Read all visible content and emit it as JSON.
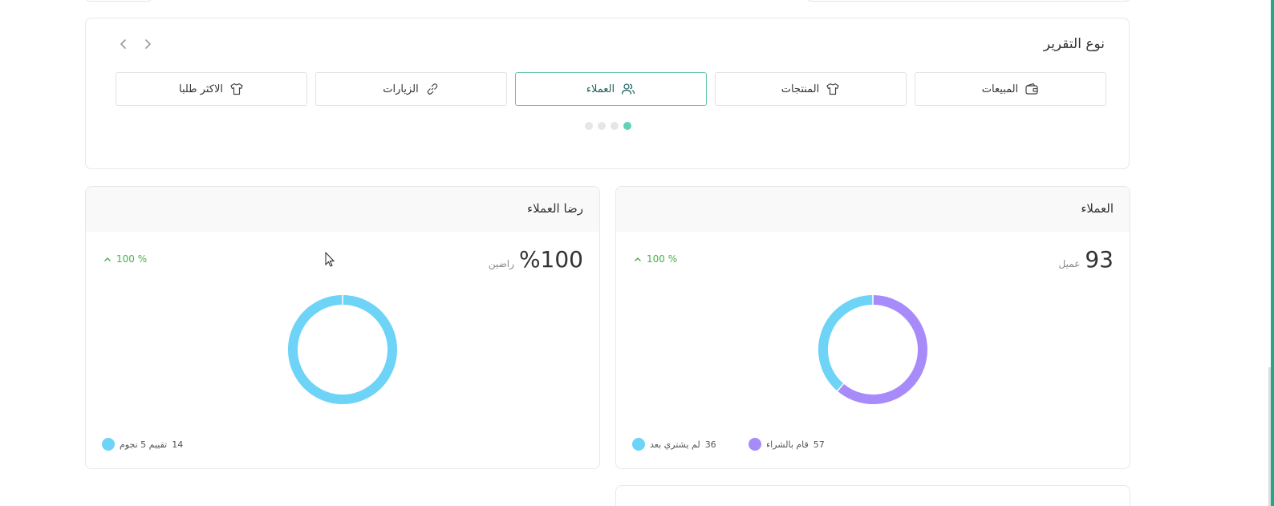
{
  "report_section": {
    "title": "نوع التقرير",
    "tabs": [
      {
        "label": "المبيعات",
        "icon": "wallet-icon",
        "active": false
      },
      {
        "label": "المنتجات",
        "icon": "tshirt-icon",
        "active": false
      },
      {
        "label": "العملاء",
        "icon": "users-icon",
        "active": true
      },
      {
        "label": "الزيارات",
        "icon": "link-icon",
        "active": false
      },
      {
        "label": "الاكثر طلبا",
        "icon": "tshirt-icon",
        "active": false
      }
    ],
    "pagination_active_index": 0,
    "pagination_count": 4
  },
  "customers_card": {
    "title": "العملاء",
    "value": "93",
    "unit": "عميل",
    "trend": "100 %",
    "chart_data": {
      "type": "pie",
      "categories": [
        "قام بالشراء",
        "لم يشتري بعد"
      ],
      "values": [
        57,
        36
      ],
      "colors": [
        "#a78bfa",
        "#6dd3f7"
      ]
    },
    "legend": [
      {
        "count": "57",
        "label": "قام بالشراء",
        "color": "#a78bfa"
      },
      {
        "count": "36",
        "label": "لم يشتري بعد",
        "color": "#6dd3f7"
      }
    ]
  },
  "satisfaction_card": {
    "title": "رضا العملاء",
    "value": "%100",
    "unit": "راضين",
    "trend": "100 %",
    "chart_data": {
      "type": "pie",
      "categories": [
        "تقييم 5 نجوم"
      ],
      "values": [
        14
      ],
      "colors": [
        "#6dd3f7"
      ]
    },
    "legend": [
      {
        "count": "14",
        "label": "تقييم 5 نجوم",
        "color": "#6dd3f7"
      }
    ]
  },
  "colors": {
    "accent": "#5fc5a8",
    "trend_up": "#4caf50",
    "purple": "#a78bfa",
    "cyan": "#6dd3f7"
  }
}
